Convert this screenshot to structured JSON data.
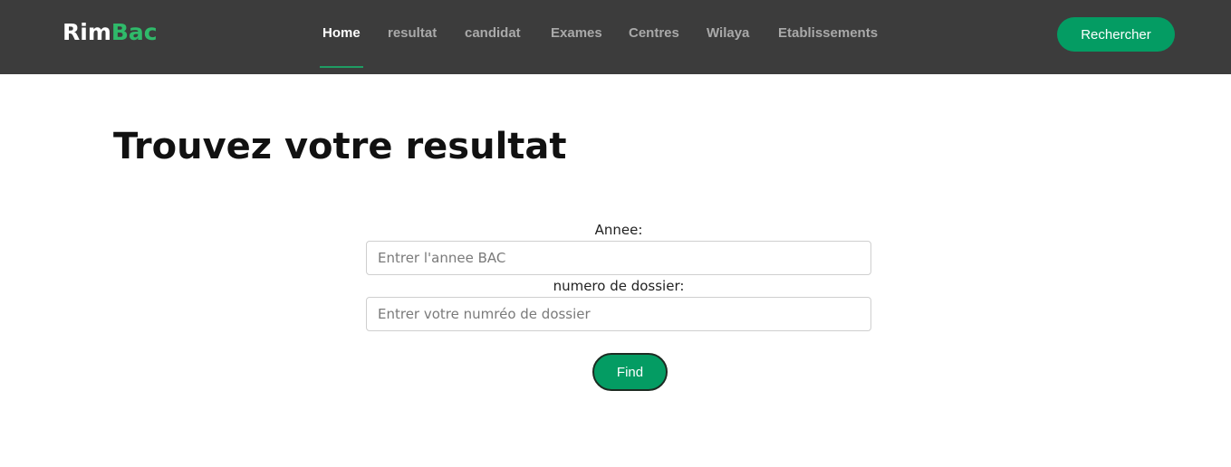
{
  "brand": {
    "part1": "Rim",
    "part2": "Bac"
  },
  "nav": {
    "items": [
      {
        "label": "Home",
        "active": true
      },
      {
        "label": "resultat",
        "active": false
      },
      {
        "label": "candidat",
        "active": false
      },
      {
        "label": "Exames",
        "active": false
      },
      {
        "label": "Centres",
        "active": false
      },
      {
        "label": "Wilaya",
        "active": false
      },
      {
        "label": "Etablissements",
        "active": false
      }
    ],
    "search_label": "Rechercher"
  },
  "main": {
    "title": "Trouvez votre resultat",
    "form": {
      "year_label": "Annee:",
      "year_placeholder": "Entrer l'annee BAC",
      "year_value": "",
      "file_label": "numero de dossier:",
      "file_placeholder": "Entrer votre numréo de dossier",
      "file_value": "",
      "submit_label": "Find"
    }
  },
  "colors": {
    "navbar_bg": "#3c3c3c",
    "accent": "#049c63",
    "brand_green": "#2fba6a"
  }
}
